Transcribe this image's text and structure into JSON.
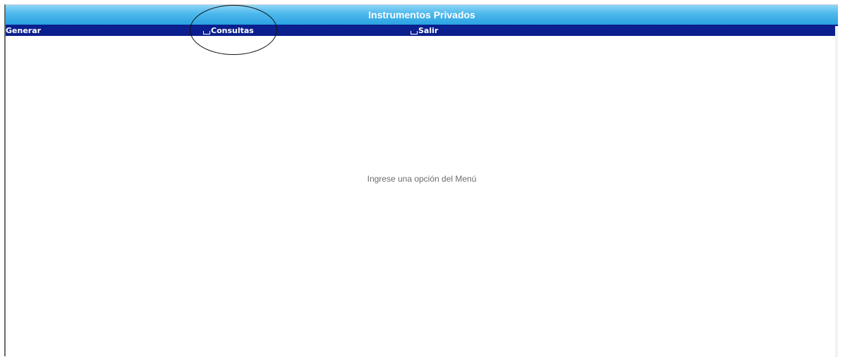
{
  "window": {
    "title": "Instrumentos Privados"
  },
  "menu": {
    "items": [
      {
        "label": "Generar",
        "icon": ""
      },
      {
        "label": "Consultas",
        "icon": "collapse-icon"
      },
      {
        "label": "Salir",
        "icon": "collapse-icon"
      }
    ]
  },
  "main": {
    "message": "Ingrese una opción del Menú"
  },
  "colors": {
    "title_bar": "#2aa2e2",
    "menu_bar": "#0c1f8e",
    "annotation": "#111111"
  }
}
